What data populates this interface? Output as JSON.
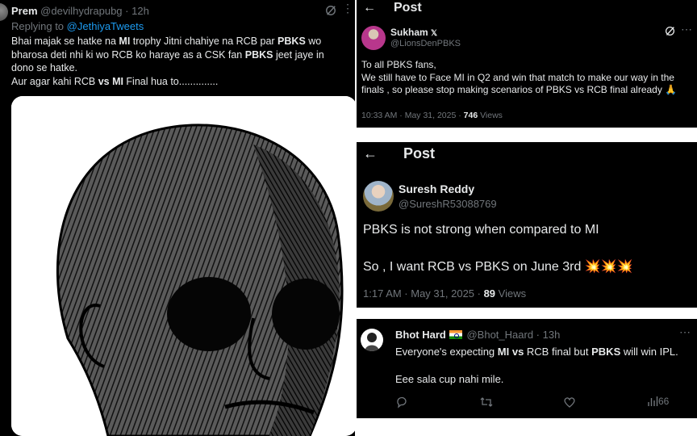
{
  "tweet1": {
    "author_name": "Prem",
    "author_handle": "@devilhydrapubg",
    "separator": "·",
    "time": "12h",
    "more_icon": "more-icon",
    "replying_prefix": "Replying to",
    "replying_to": "@JethiyaTweets",
    "body": {
      "s1": "Bhai majak se hatke na ",
      "b1": "MI",
      "s2": " trophy Jitni chahiye na RCB par ",
      "b2": "PBKS",
      "s3": " wo bharosa deti nhi ki wo RCB ko haraye as a CSK fan ",
      "b3": "PBKS",
      "s4": " jeet jaye in dono se hatke.",
      "s5": "Aur agar kahi RCB ",
      "b4": "vs MI",
      "s6": " Final hua to.............."
    },
    "image_icon": "wojak-meme-image"
  },
  "tweet2": {
    "header_title": "Post",
    "author_name": "Sukham",
    "author_handle": "@LionsDenPBKS",
    "body_lines": [
      "To all PBKS fans,",
      "We still have to Face MI in Q2 and win that match to make our way in the finals , so please stop making scenarios of PBKS vs RCB final already 🙏"
    ],
    "timestamp": "10:33 AM · May 31, 2025 · ",
    "views_count": "746",
    "views_label": " Views"
  },
  "tweet3": {
    "header_title": "Post",
    "author_name": "Suresh Reddy",
    "author_handle": "@SureshR53088769",
    "line1": "PBKS is not strong when compared to MI",
    "line2": "So , I want RCB vs PBKS on June 3rd 💥💥💥",
    "timestamp": "1:17 AM · May 31, 2025 · ",
    "views_count": "89",
    "views_label": " Views"
  },
  "tweet4": {
    "author_name": "Bhot Hard",
    "author_handle": "@Bhot_Haard",
    "separator": "·",
    "time": "13h",
    "line1": {
      "s1": "Everyone's expecting ",
      "b1": "MI vs",
      "s2": " RCB final but ",
      "b2": "PBKS",
      "s3": " will win IPL."
    },
    "line2": "Eee sala cup nahi mile.",
    "views_count": "66"
  },
  "colors": {
    "tweet_bg": "#000000",
    "text": "#e7e9ea",
    "muted": "#71767b",
    "link": "#1d9bf0"
  }
}
